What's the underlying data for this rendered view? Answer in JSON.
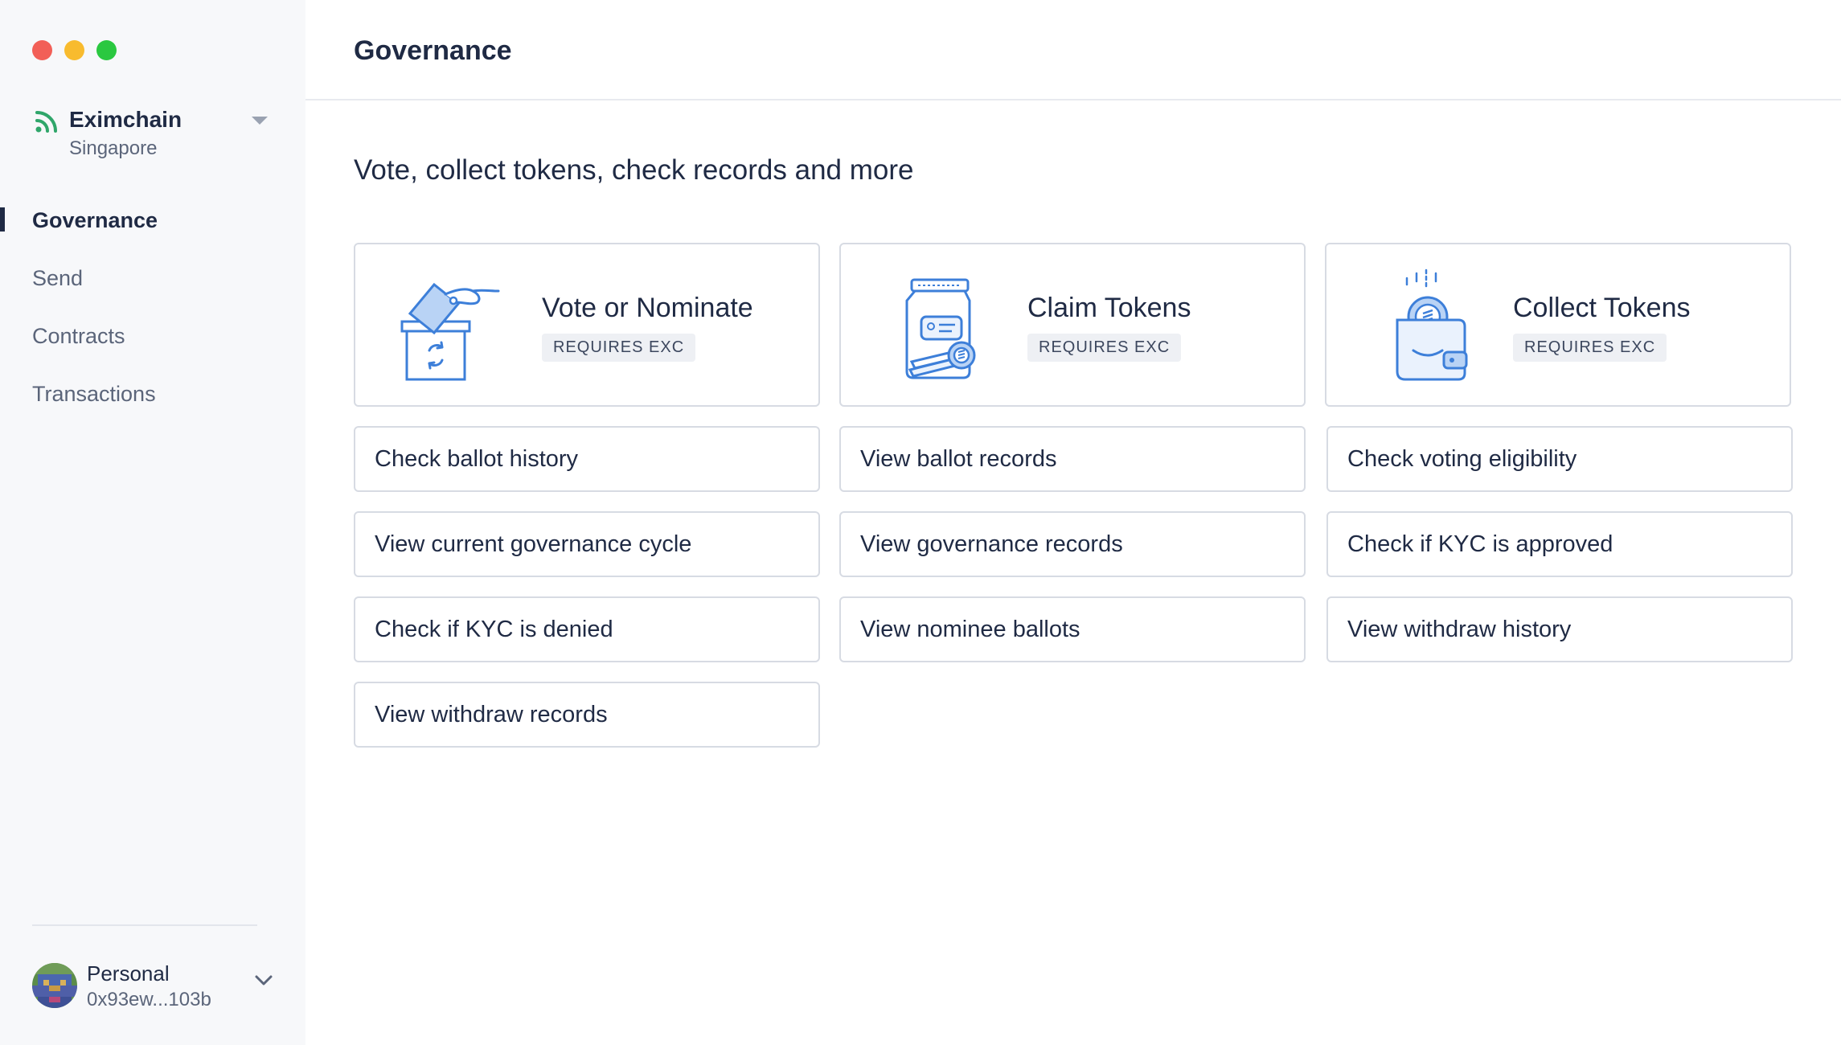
{
  "window": {
    "controls": {
      "close_color": "#f25f57",
      "minimize_color": "#f8bb2e",
      "maximize_color": "#2ac840"
    }
  },
  "sidebar": {
    "network": {
      "name": "Eximchain",
      "location": "Singapore",
      "icon": "signal-icon",
      "icon_color": "#2fa66a"
    },
    "nav": [
      {
        "label": "Governance",
        "active": true
      },
      {
        "label": "Send",
        "active": false
      },
      {
        "label": "Contracts",
        "active": false
      },
      {
        "label": "Transactions",
        "active": false
      }
    ],
    "account": {
      "name": "Personal",
      "address": "0x93ew...103b"
    }
  },
  "header": {
    "title": "Governance"
  },
  "main": {
    "subtitle": "Vote, collect tokens, check records and more",
    "feature_cards": [
      {
        "title": "Vote or Nominate",
        "badge": "REQUIRES EXC",
        "icon": "ballot-box-icon"
      },
      {
        "title": "Claim Tokens",
        "badge": "REQUIRES EXC",
        "icon": "token-jar-icon"
      },
      {
        "title": "Collect Tokens",
        "badge": "REQUIRES EXC",
        "icon": "wallet-coin-icon"
      }
    ],
    "actions": [
      "Check ballot history",
      "View ballot records",
      "Check voting eligibility",
      "View current governance cycle",
      "View governance records",
      "Check if KYC is approved",
      "Check if KYC is denied",
      "View nominee ballots",
      "View withdraw history",
      "View withdraw records"
    ]
  },
  "colors": {
    "text_primary": "#1f2a44",
    "text_secondary": "#5b657a",
    "accent_blue": "#3d7fd9",
    "border": "#d7dbe3"
  }
}
